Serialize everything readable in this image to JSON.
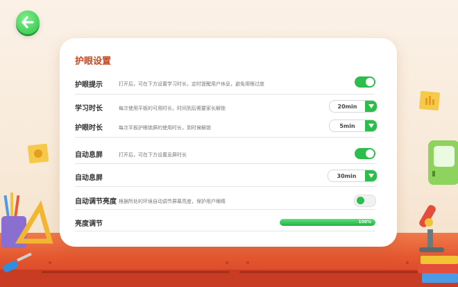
{
  "nav": {
    "back_icon": "arrow-left-icon"
  },
  "settings": {
    "title": "护眼设置",
    "rows": [
      {
        "label": "护眼提示",
        "desc": "打开后，可在下方设置学习时长，定时提醒用户休息，避免用眼过度",
        "toggle": "on"
      },
      {
        "label": "学习时长",
        "desc": "每次使用平板的可用时长，时间到后需要家长解锁",
        "select": "20min"
      },
      {
        "label": "护眼时长",
        "desc": "每次平板护眼锁屏的使用时长，到时候解锁",
        "select": "5min"
      },
      {
        "label": "自动息屏",
        "desc": "打开后，可在下方设置息屏时长",
        "toggle": "on"
      },
      {
        "label": "自动息屏",
        "desc": "",
        "select": "30min"
      },
      {
        "label": "自动调节亮度",
        "desc": "根据所处的环境自动调节屏幕亮度，保护用户眼睛",
        "toggle": "off"
      },
      {
        "label": "亮度调节",
        "desc": "",
        "progress_label": "100%",
        "progress": 1.0
      }
    ]
  },
  "colors": {
    "accent": "#2dbd4c",
    "title": "#c04a23",
    "desk": "#e4572f"
  }
}
